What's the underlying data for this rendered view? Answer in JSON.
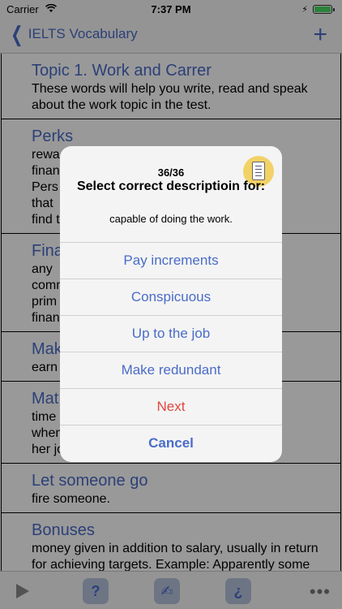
{
  "status_bar": {
    "carrier": "Carrier",
    "time": "7:37 PM",
    "battery_level": 1.0
  },
  "nav": {
    "back_label": "IELTS Vocabulary"
  },
  "list_items": [
    {
      "title": "Topic 1. Work and Carrer",
      "description": "These words will help you write, read and speak about the work topic in the test."
    },
    {
      "title": "Perks",
      "description": "rewa\nfinan\nPers\nthat \nfind t"
    },
    {
      "title": "Fina",
      "description": "any \ncomm\nprim\nfinan"
    },
    {
      "title": "Mak",
      "description": "earn"
    },
    {
      "title": "Mat",
      "description": "time \nwhen\nher jo"
    },
    {
      "title": "Let someone go",
      "description": "fire someone."
    },
    {
      "title": "Bonuses",
      "description": "money given in addition to salary, usually in return for achieving targets. Example: Apparently some investment bankers can"
    }
  ],
  "quiz": {
    "counter": "36/36",
    "title": "Select correct descriptioin for:",
    "prompt": "capable of doing the work.",
    "options": [
      "Pay increments",
      "Conspicuous",
      "Up to the job",
      "Make redundant"
    ],
    "next_label": "Next",
    "cancel_label": "Cancel"
  },
  "tab_bar": {
    "help_label": "?",
    "quiz_label": "✍",
    "question_label": "¿"
  },
  "colors": {
    "accent": "#4a6cc9",
    "destructive": "#e0483e",
    "icon_badge": "#f2d266"
  }
}
